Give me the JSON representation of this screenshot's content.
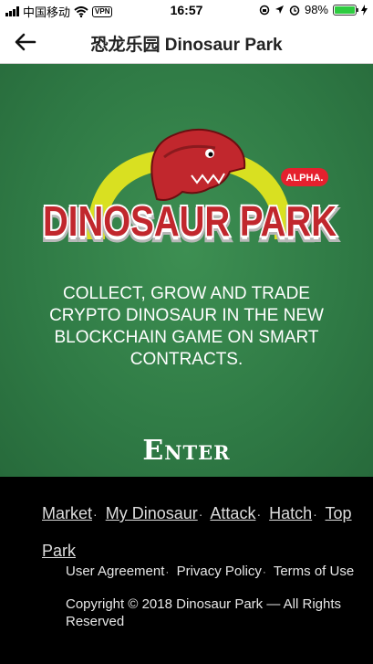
{
  "status_bar": {
    "carrier": "中国移动",
    "vpn": "VPN",
    "time": "16:57",
    "battery": "98%",
    "battery_level": 0.98
  },
  "nav": {
    "title": "恐龙乐园 Dinosaur Park",
    "back_icon": "back-arrow-icon"
  },
  "hero": {
    "logo_text": "DINOSAUR PARK",
    "logo_badge": "ALPHA.",
    "tagline": "COLLECT, GROW AND TRADE CRYPTO DINOSAUR IN THE NEW BLOCKCHAIN GAME ON SMART CONTRACTS.",
    "enter_label": "Enter",
    "background_color": "#2f7a45"
  },
  "footer": {
    "links": {
      "market": "Market",
      "my_dinosaur": "My Dinosaur",
      "attack": "Attack",
      "hatch": "Hatch",
      "top_park": "Top Park"
    },
    "separator": "·",
    "legal": {
      "user_agreement": "User Agreement",
      "privacy_policy": "Privacy Policy",
      "terms_of_use": "Terms of Use"
    },
    "copyright": "Copyright © 2018 Dinosaur Park — All Rights Reserved"
  }
}
